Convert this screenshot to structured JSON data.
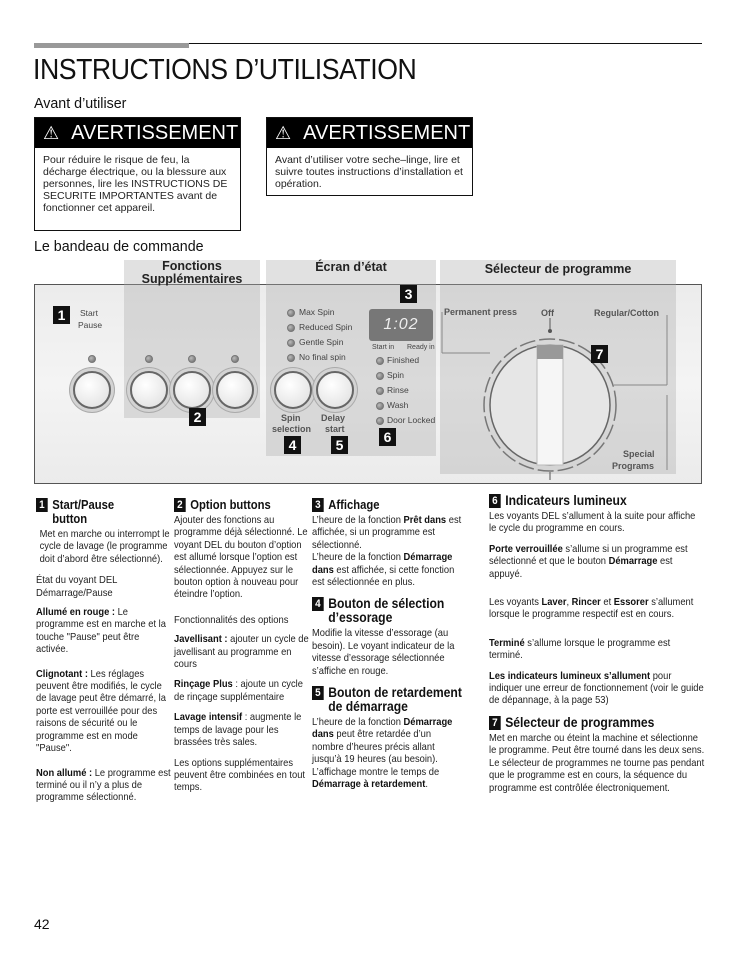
{
  "header": {
    "title": "INSTRUCTIONS D’UTILISATION",
    "section_before_use": "Avant d’utiliser",
    "section_control_panel": "Le bandeau de commande"
  },
  "warnings": [
    {
      "icon": "warning-triangle-icon",
      "icon_glyph": "⚠",
      "title": "AVERTISSEMENT",
      "body": "Pour réduire le risque de feu, la décharge électrique, ou la blessure aux personnes, lire les INSTRUCTIONS DE SECURITE IMPORTANTES avant de fonctionner cet appareil."
    },
    {
      "icon": "warning-triangle-icon",
      "icon_glyph": "⚠",
      "title": "AVERTISSEMENT",
      "body": "Avant d’utiliser votre seche–linge, lire et suivre toutes instructions d’installation et opération."
    }
  ],
  "panel": {
    "zones": {
      "options": "Fonctions Supplémentaires",
      "status": "Écran d’état",
      "selector": "Sélecteur de programme"
    },
    "start_label_1": "Start",
    "start_label_2": "Pause",
    "spin_levels": [
      "Max Spin",
      "Reduced Spin",
      "Gentle Spin",
      "No final spin"
    ],
    "display_value": "1:02",
    "display_start_in": "Start in",
    "display_ready_in": "Ready in",
    "status_leds": [
      "Finished",
      "Spin",
      "Rinse",
      "Wash",
      "Door Locked"
    ],
    "spin_button_1": "Spin",
    "spin_button_2": "selection",
    "delay_button_1": "Delay",
    "delay_button_2": "start",
    "dial_permanent_press": "Permanent press",
    "dial_off": "Off",
    "dial_regular_cotton": "Regular/Cotton",
    "dial_special_1": "Special",
    "dial_special_2": "Programs",
    "callouts": [
      "1",
      "2",
      "3",
      "4",
      "5",
      "6",
      "7"
    ]
  },
  "sections": {
    "s1": {
      "num": "1",
      "title": "Start/Pause button",
      "text": "Met en marche ou interrompt le cycle de lavage (le programme doit d’abord être sélectionné).",
      "led_state_title": "État du voyant DEL Démarrage/Pause",
      "on_label": "Allumé en rouge :",
      "on_text": " Le programme est en marche et la touche \"Pause\" peut être activée.",
      "blink_label": "Clignotant :",
      "blink_text": " Les réglages peuvent être modifiés, le cycle de lavage peut être démarré, la porte est verrouillée pour des raisons de sécurité ou le programme est en mode \"Pause\".",
      "off_label": "Non allumé :",
      "off_text": " Le programme est terminé ou il n’y a plus de programme sélectionné."
    },
    "s2": {
      "num": "2",
      "title": "Option buttons",
      "text": "Ajouter des fonctions au programme déjà sélectionné.  Le voyant DEL du bouton d’option est allumé lorsque l’option est sélectionnée. Appuyez sur le bouton option à nouveau pour éteindre l’option.",
      "features_title": "Fonctionnalités des options",
      "bleach_label": "Javellisant :",
      "bleach_text": " ajouter un cycle de javellisant au programme en cours",
      "rinse_label": "Rinçage Plus",
      "rinse_text": " : ajoute un cycle de rinçage supplémentaire",
      "intensive_label": "Lavage intensif",
      "intensive_text": " : augmente le temps de lavage pour les brassées très sales.",
      "combine_text": "Les options supplémentaires peuvent être combinées en tout temps."
    },
    "s3": {
      "num": "3",
      "title": "Affichage",
      "t1": "L’heure de la fonction ",
      "b1": "Prêt dans",
      "t2": " est affichée, si un programme est sélectionné.",
      "t3": "L’heure de la fonction ",
      "b2": "Démarrage dans",
      "t4": " est affichée, si cette fonction est sélectionnée en plus."
    },
    "s4": {
      "num": "4",
      "title": "Bouton de sélection d’essorage",
      "text": "Modifie la vitesse d’essorage (au besoin). Le voyant indicateur de la vitesse d’essorage sélectionnée s’affiche en rouge."
    },
    "s5": {
      "num": "5",
      "title": "Bouton de retardement de démarrage",
      "t1": "L’heure de la fonction ",
      "b1": "Démarrage dans",
      "t2": " peut être retardée d’un nombre d’heures précis allant jusqu’à 19 heures (au besoin). L’affichage montre le temps de ",
      "b2": "Démarrage à retardement",
      "t3": "."
    },
    "s6": {
      "num": "6",
      "title": "Indicateurs lumineux",
      "text": "Les voyants DEL s’allument à la suite pour affiche le cycle du programme en cours.",
      "door_label": "Porte verrouillée",
      "door_t1": " s’allume si un programme est sélectionné et que le bouton ",
      "door_b": "Démarrage",
      "door_t2": " est appuyé.",
      "leds_t1": "Les voyants ",
      "leds_b1": "Laver",
      "leds_sep1": ", ",
      "leds_b2": "Rincer",
      "leds_sep2": " et ",
      "leds_b3": "Essorer",
      "leds_t2": " s’allument lorsque le programme respectif est en cours.",
      "finished_label": "Terminé",
      "finished_text": " s’allume lorsque le programme est terminé.",
      "error_label": "Les indicateurs lumineux s’allument",
      "error_text": " pour indiquer une erreur de fonctionnement (voir le guide de dépannage, à la page 53)"
    },
    "s7": {
      "num": "7",
      "title": "Sélecteur de programmes",
      "text": "Met en marche ou éteint la machine et sélectionne le programme. Peut être tourné dans les deux sens. Le sélecteur de programmes ne tourne pas pendant que le programme est en cours, la séquence du programme est contrôlée électroniquement."
    }
  },
  "footer": {
    "page_number": "42"
  }
}
